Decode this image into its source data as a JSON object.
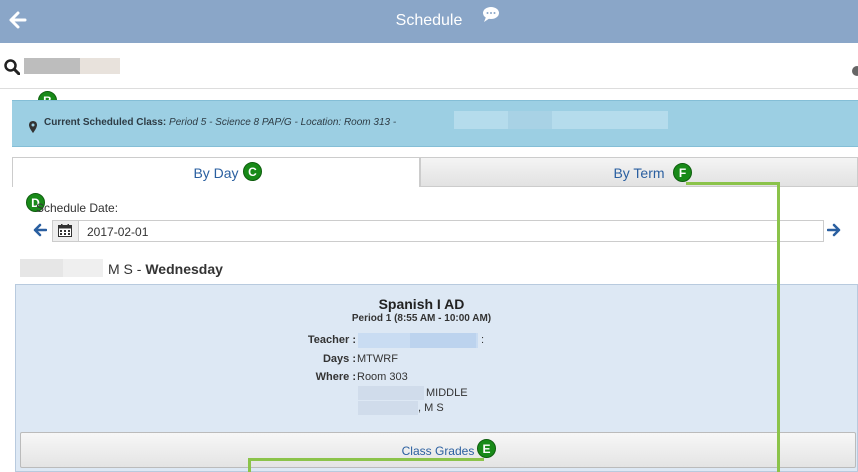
{
  "header": {
    "title": "Schedule"
  },
  "banner": {
    "label": "Current Scheduled Class:",
    "detail": "Period 5 - Science 8 PAP/G - Location: Room 313 -"
  },
  "tabs": [
    {
      "label": "By Day",
      "active": true
    },
    {
      "label": "By Term",
      "active": false
    }
  ],
  "date": {
    "label": "Schedule Date:",
    "value": "2017-02-01"
  },
  "school_day": {
    "school_suffix": "M S -",
    "weekday": "Wednesday"
  },
  "course": {
    "title": "Spanish I AD",
    "period": "Period 1 (8:55 AM - 10:00 AM)",
    "teacher_label": "Teacher :",
    "teacher_suffix": ":",
    "days_label": "Days :",
    "days_value": "MTWRF",
    "where_label": "Where :",
    "where_value": "Room 303",
    "where_line2": "MIDDLE",
    "where_line3": ", M S",
    "grades_button": "Class Grades"
  },
  "annotations": {
    "B": "B",
    "C": "C",
    "D": "D",
    "E": "E",
    "F": "F",
    "badge_color": "#188a18",
    "line_color": "#8bc34a"
  },
  "colors": {
    "header_bg": "#8aa6c8",
    "banner_bg": "#9ccfe3",
    "panel_bg": "#dde8f4",
    "link_blue": "#2a5fa0"
  }
}
